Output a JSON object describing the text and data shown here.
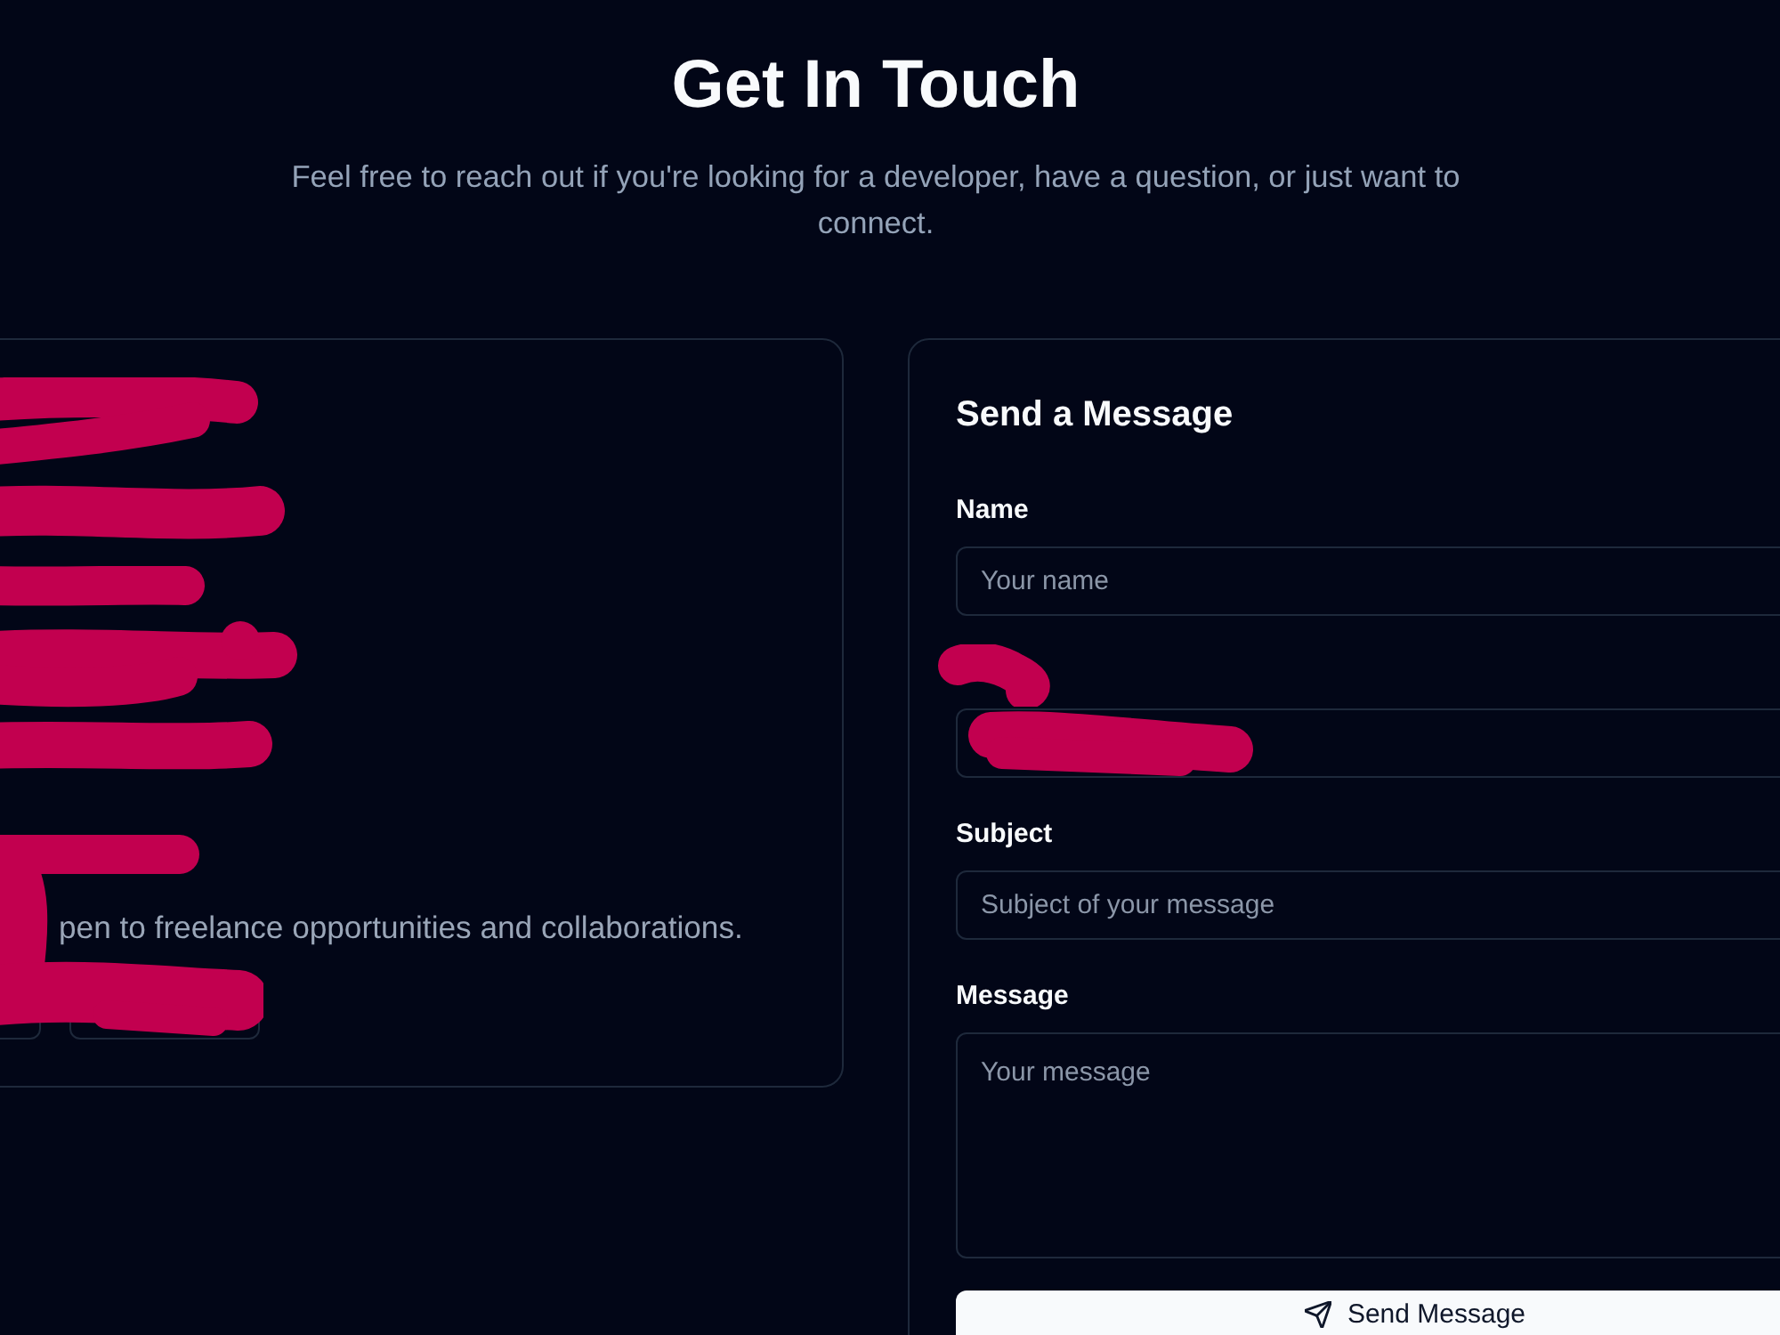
{
  "header": {
    "title": "Get In Touch",
    "subtitle": "Feel free to reach out if you're looking for a developer, have a question, or just want to connect."
  },
  "info_card": {
    "redacted": true,
    "text": "pen to freelance opportunities and collaborations."
  },
  "form": {
    "title": "Send a Message",
    "fields": [
      {
        "kind": "input",
        "label": "Name",
        "placeholder": "Your name",
        "redacted": false
      },
      {
        "kind": "input",
        "redacted": true
      },
      {
        "kind": "input",
        "label": "Subject",
        "placeholder": "Subject of your message",
        "redacted": false
      },
      {
        "kind": "textarea",
        "label": "Message",
        "placeholder": "Your message",
        "redacted": false
      }
    ],
    "submit": {
      "label": "Send Message"
    }
  }
}
